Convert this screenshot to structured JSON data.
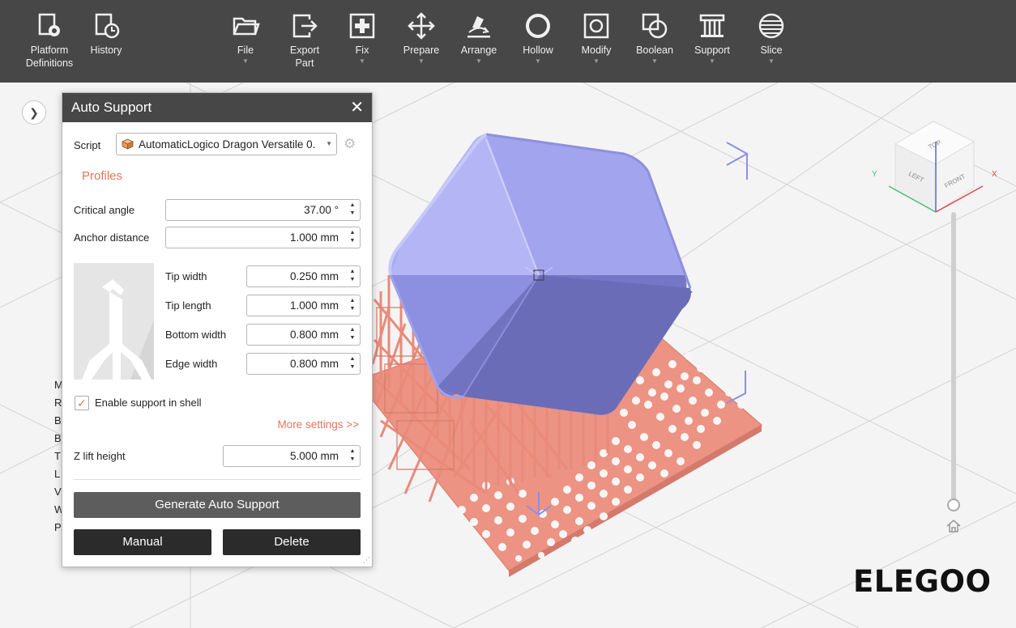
{
  "toolbar": {
    "platform": "Platform\nDefinitions",
    "history": "History",
    "file": "File",
    "export": "Export\nPart",
    "fix": "Fix",
    "prepare": "Prepare",
    "arrange": "Arrange",
    "hollow": "Hollow",
    "modify": "Modify",
    "boolean": "Boolean",
    "support": "Support",
    "slice": "Slice"
  },
  "dialog": {
    "title": "Auto Support",
    "script_label": "Script",
    "script_value": "AutomaticLogico Dragon Versatile 0.",
    "profiles": "Profiles",
    "critical_angle_label": "Critical angle",
    "critical_angle_value": "37.00 °",
    "anchor_distance_label": "Anchor distance",
    "anchor_distance_value": "1.000 mm",
    "tip_width_label": "Tip width",
    "tip_width_value": "0.250 mm",
    "tip_length_label": "Tip length",
    "tip_length_value": "1.000 mm",
    "bottom_width_label": "Bottom width",
    "bottom_width_value": "0.800 mm",
    "edge_width_label": "Edge width",
    "edge_width_value": "0.800 mm",
    "enable_shell_label": "Enable support in shell",
    "enable_shell_checked": true,
    "more_settings": "More settings >>",
    "z_lift_label": "Z lift height",
    "z_lift_value": "5.000 mm",
    "generate_label": "Generate Auto Support",
    "manual_label": "Manual",
    "delete_label": "Delete"
  },
  "behind_list_initials": [
    "M",
    "R",
    "B",
    "B",
    "T",
    "L",
    "V",
    "W",
    "P"
  ],
  "view_cube": {
    "top": "TOP",
    "left": "LEFT",
    "front": "FRONT",
    "x": "X",
    "y": "Y"
  },
  "logo": "ELEGOO",
  "colors": {
    "accent": "#e8735a",
    "toolbar_bg": "#474747",
    "model": "#9c9eec",
    "supports": "#ec9384"
  }
}
